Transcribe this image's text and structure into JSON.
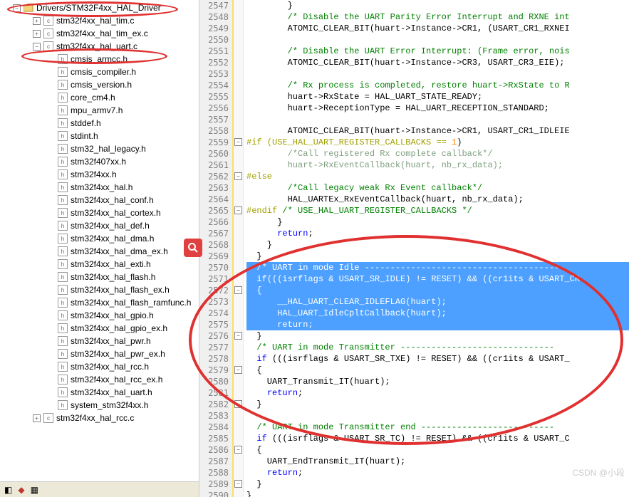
{
  "tree": {
    "root": "Drivers/STM32F4xx_HAL_Driver",
    "items": [
      {
        "name": "stm32f4xx_hal_tim.c",
        "type": "c",
        "exp": "+",
        "indent": 40
      },
      {
        "name": "stm32f4xx_hal_tim_ex.c",
        "type": "c",
        "exp": "+",
        "indent": 40
      },
      {
        "name": "stm32f4xx_hal_uart.c",
        "type": "c",
        "exp": "-",
        "indent": 40
      },
      {
        "name": "cmsis_armcc.h",
        "type": "h",
        "indent": 60
      },
      {
        "name": "cmsis_compiler.h",
        "type": "h",
        "indent": 60
      },
      {
        "name": "cmsis_version.h",
        "type": "h",
        "indent": 60
      },
      {
        "name": "core_cm4.h",
        "type": "h",
        "indent": 60
      },
      {
        "name": "mpu_armv7.h",
        "type": "h",
        "indent": 60
      },
      {
        "name": "stddef.h",
        "type": "h",
        "indent": 60
      },
      {
        "name": "stdint.h",
        "type": "h",
        "indent": 60
      },
      {
        "name": "stm32_hal_legacy.h",
        "type": "h",
        "indent": 60
      },
      {
        "name": "stm32f407xx.h",
        "type": "h",
        "indent": 60
      },
      {
        "name": "stm32f4xx.h",
        "type": "h",
        "indent": 60
      },
      {
        "name": "stm32f4xx_hal.h",
        "type": "h",
        "indent": 60
      },
      {
        "name": "stm32f4xx_hal_conf.h",
        "type": "h",
        "indent": 60
      },
      {
        "name": "stm32f4xx_hal_cortex.h",
        "type": "h",
        "indent": 60
      },
      {
        "name": "stm32f4xx_hal_def.h",
        "type": "h",
        "indent": 60
      },
      {
        "name": "stm32f4xx_hal_dma.h",
        "type": "h",
        "indent": 60
      },
      {
        "name": "stm32f4xx_hal_dma_ex.h",
        "type": "h",
        "indent": 60
      },
      {
        "name": "stm32f4xx_hal_exti.h",
        "type": "h",
        "indent": 60
      },
      {
        "name": "stm32f4xx_hal_flash.h",
        "type": "h",
        "indent": 60
      },
      {
        "name": "stm32f4xx_hal_flash_ex.h",
        "type": "h",
        "indent": 60
      },
      {
        "name": "stm32f4xx_hal_flash_ramfunc.h",
        "type": "h",
        "indent": 60
      },
      {
        "name": "stm32f4xx_hal_gpio.h",
        "type": "h",
        "indent": 60
      },
      {
        "name": "stm32f4xx_hal_gpio_ex.h",
        "type": "h",
        "indent": 60
      },
      {
        "name": "stm32f4xx_hal_pwr.h",
        "type": "h",
        "indent": 60
      },
      {
        "name": "stm32f4xx_hal_pwr_ex.h",
        "type": "h",
        "indent": 60
      },
      {
        "name": "stm32f4xx_hal_rcc.h",
        "type": "h",
        "indent": 60
      },
      {
        "name": "stm32f4xx_hal_rcc_ex.h",
        "type": "h",
        "indent": 60
      },
      {
        "name": "stm32f4xx_hal_uart.h",
        "type": "h",
        "indent": 60
      },
      {
        "name": "system_stm32f4xx.h",
        "type": "h",
        "indent": 60
      },
      {
        "name": "stm32f4xx_hal_rcc.c",
        "type": "c",
        "exp": "+",
        "indent": 40
      }
    ]
  },
  "lines": {
    "start": 2547,
    "end": 2590
  },
  "code": [
    {
      "n": 2547,
      "t": "        }"
    },
    {
      "n": 2548,
      "t": "        ",
      "c": "/* Disable the UART Parity Error Interrupt and RXNE int"
    },
    {
      "n": 2549,
      "t": "        ATOMIC_CLEAR_BIT(huart->Instance->CR1, (USART_CR1_RXNEI"
    },
    {
      "n": 2550,
      "t": ""
    },
    {
      "n": 2551,
      "t": "        ",
      "c": "/* Disable the UART Error Interrupt: (Frame error, nois"
    },
    {
      "n": 2552,
      "t": "        ATOMIC_CLEAR_BIT(huart->Instance->CR3, USART_CR3_EIE);"
    },
    {
      "n": 2553,
      "t": ""
    },
    {
      "n": 2554,
      "t": "        ",
      "c": "/* Rx process is completed, restore huart->RxState to R"
    },
    {
      "n": 2555,
      "t": "        huart->RxState = HAL_UART_STATE_READY;"
    },
    {
      "n": 2556,
      "t": "        huart->ReceptionType = HAL_UART_RECEPTION_STANDARD;"
    },
    {
      "n": 2557,
      "t": ""
    },
    {
      "n": 2558,
      "t": "        ATOMIC_CLEAR_BIT(huart->Instance->CR1, USART_CR1_IDLEIE"
    },
    {
      "n": 2559,
      "pp": "#if (USE_HAL_UART_REGISTER_CALLBACKS == ",
      "num": "1",
      "tail": ")",
      "fold": "-"
    },
    {
      "n": 2560,
      "dis": "        /*Call registered Rx complete callback*/"
    },
    {
      "n": 2561,
      "dis": "        huart->RxEventCallback(huart, nb_rx_data);"
    },
    {
      "n": 2562,
      "pp": "#else",
      "fold": "-"
    },
    {
      "n": 2563,
      "t": "        ",
      "c": "/*Call legacy weak Rx Event callback*/"
    },
    {
      "n": 2564,
      "t": "        HAL_UARTEx_RxEventCallback(huart, nb_rx_data);"
    },
    {
      "n": 2565,
      "pp": "#endif ",
      "c": "/* USE_HAL_UART_REGISTER_CALLBACKS */",
      "fold": "-"
    },
    {
      "n": 2566,
      "t": "      }"
    },
    {
      "n": 2567,
      "t": "      ",
      "k": "return",
      ";": ";"
    },
    {
      "n": 2568,
      "t": "    }"
    },
    {
      "n": 2569,
      "t": "  }"
    },
    {
      "n": 2570,
      "sel": true,
      "t": "  ",
      "c": "/* UART in mode Idle --------------------------------------"
    },
    {
      "n": 2571,
      "sel": true,
      "t": "  ",
      "k": "if",
      "tail": "(((isrflags & USART_SR_IDLE) != RESET) && ((cr1its & USART_CR"
    },
    {
      "n": 2572,
      "sel": true,
      "t": "  {",
      "fold": "-"
    },
    {
      "n": 2573,
      "sel": true,
      "t": "      __HAL_UART_CLEAR_IDLEFLAG(huart);"
    },
    {
      "n": 2574,
      "sel": true,
      "t": "      HAL_UART_IdleCpltCallback(huart);"
    },
    {
      "n": 2575,
      "sel": true,
      "t": "      ",
      "k": "return",
      ";": ";"
    },
    {
      "n": 2576,
      "t": "  }",
      "fold": "-"
    },
    {
      "n": 2577,
      "t": "  ",
      "c": "/* UART in mode Transmitter ------------------------------"
    },
    {
      "n": 2578,
      "t": "  ",
      "k": "if",
      "tail": " (((isrflags & USART_SR_TXE) != RESET) && ((cr1its & USART_"
    },
    {
      "n": 2579,
      "t": "  {",
      "fold": "-"
    },
    {
      "n": 2580,
      "t": "    UART_Transmit_IT(huart);"
    },
    {
      "n": 2581,
      "t": "    ",
      "k": "return",
      ";": ";"
    },
    {
      "n": 2582,
      "t": "  }",
      "fold": "-"
    },
    {
      "n": 2583,
      "t": ""
    },
    {
      "n": 2584,
      "t": "  ",
      "c": "/* UART in mode Transmitter end --------------------------"
    },
    {
      "n": 2585,
      "t": "  ",
      "k": "if",
      "tail": " (((isrflags & USART_SR_TC) != RESET) && ((cr1its & USART_C"
    },
    {
      "n": 2586,
      "t": "  {",
      "fold": "-"
    },
    {
      "n": 2587,
      "t": "    UART_EndTransmit_IT(huart);"
    },
    {
      "n": 2588,
      "t": "    ",
      "k": "return",
      ";": ";"
    },
    {
      "n": 2589,
      "t": "  }",
      "fold": "-"
    },
    {
      "n": 2590,
      "t": "}"
    }
  ],
  "watermark": "CSDN @小段"
}
